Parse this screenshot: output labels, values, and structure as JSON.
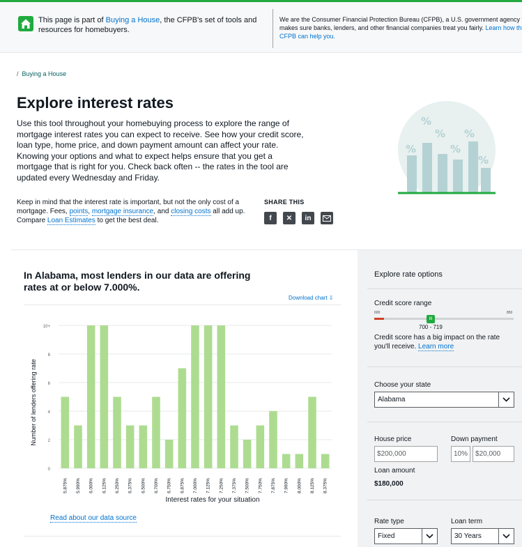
{
  "topbar": {
    "left_pre": "This page is part of ",
    "left_link": "Buying a House",
    "left_post": ", the CFPB's set of tools and resources for homebuyers.",
    "right_text": "We are the Consumer Financial Protection Bureau (CFPB), a U.S. government agency that makes sure banks, lenders, and other financial companies treat you fairly. ",
    "right_link": "Learn how the CFPB can help you."
  },
  "breadcrumb": {
    "separator": "/",
    "item": "Buying a House"
  },
  "page": {
    "title": "Explore interest rates",
    "intro": "Use this tool throughout your homebuying process to explore the range of mortgage interest rates you can expect to receive. See how your credit score, loan type, home price, and down payment amount can affect your rate. Knowing your options and what to expect helps ensure that you get a mortgage that is right for you. Check back often -- the rates in the tool are updated every Wednesday and Friday.",
    "keep_1": "Keep in mind that the interest rate is important, but not the only cost of a mortgage. Fees, ",
    "keep_link1": "points",
    "keep_2": ", ",
    "keep_link2": "mortgage insurance",
    "keep_3": ", and ",
    "keep_link3": "closing costs",
    "keep_4": " all add up. Compare ",
    "keep_link4": "Loan Estimates",
    "keep_5": " to get the best deal."
  },
  "share": {
    "title": "SHARE THIS",
    "icons": [
      "facebook-icon",
      "x-icon",
      "linkedin-icon",
      "email-icon"
    ]
  },
  "chart_section": {
    "heading": "In Alabama, most lenders in our data are offering rates at or below 7.000%.",
    "download": "Download chart",
    "data_source": "Read about our data source"
  },
  "chart_data": {
    "type": "bar",
    "categories": [
      "5.875%",
      "5.990%",
      "6.000%",
      "6.125%",
      "6.250%",
      "6.375%",
      "6.500%",
      "6.700%",
      "6.750%",
      "6.875%",
      "7.000%",
      "7.125%",
      "7.250%",
      "7.375%",
      "7.500%",
      "7.750%",
      "7.875%",
      "7.990%",
      "8.000%",
      "8.125%",
      "8.375%"
    ],
    "values": [
      5,
      3,
      10,
      10,
      5,
      3,
      3,
      5,
      2,
      7,
      10,
      10,
      10,
      3,
      2,
      3,
      4,
      1,
      1,
      5,
      1
    ],
    "xlabel": "Interest rates for your situation",
    "ylabel": "Number of lenders offering rate",
    "yticks": [
      "0",
      "2",
      "4",
      "6",
      "8",
      "10+"
    ],
    "ylim": [
      0,
      10
    ],
    "bar_color": "#addc91",
    "grid": true
  },
  "panel": {
    "title": "Explore rate options",
    "credit_label": "Credit score range",
    "credit_min": "600",
    "credit_max": "850",
    "credit_value": "700 - 719",
    "credit_thumb": "III",
    "credit_note": "Credit score has a big impact on the rate you'll receive. ",
    "credit_link": "Learn more",
    "state_label": "Choose your state",
    "state_value": "Alabama",
    "house_label": "House price",
    "house_value": "200,000",
    "down_label": "Down payment",
    "down_pct": "10%",
    "down_value": "20,000",
    "currency": "$",
    "loan_label": "Loan amount",
    "loan_value": "$180,000",
    "rate_type_label": "Rate type",
    "rate_type_value": "Fixed",
    "loan_term_label": "Loan term",
    "loan_term_value": "30 Years"
  },
  "colors": {
    "accent_green": "#20aa3f",
    "link_blue": "#0072ce",
    "illustration": "#b4d2d3"
  }
}
